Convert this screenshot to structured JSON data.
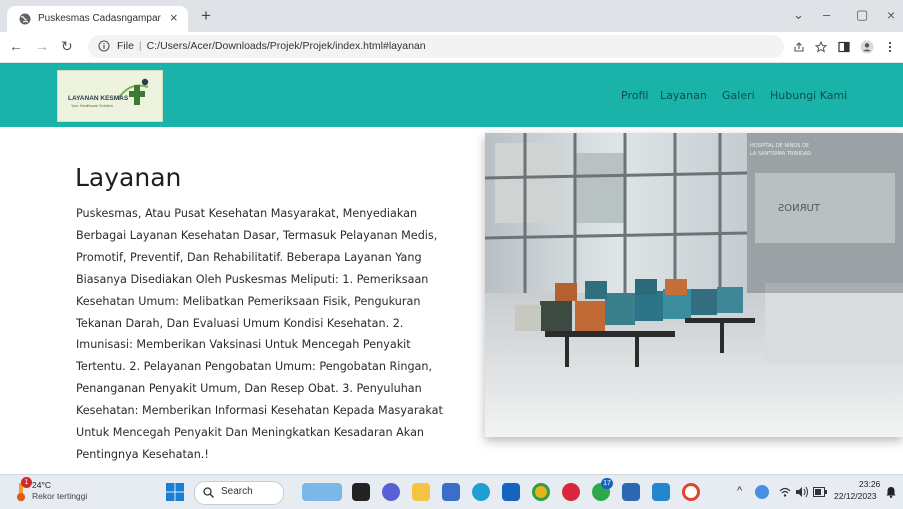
{
  "browser": {
    "tab_title": "Puskesmas Cadasngampar",
    "tab_close": "×",
    "new_tab": "+",
    "window_controls": [
      "⌄",
      "–",
      "▢",
      "×"
    ],
    "url_scheme": "File",
    "url_path": "C:/Users/Acer/Downloads/Projek/Projek/index.html#layanan",
    "nav": {
      "back": "←",
      "forward": "→",
      "reload": "↻"
    },
    "toolbar_icons": [
      "share",
      "star",
      "sidepanel",
      "profile",
      "menu"
    ]
  },
  "site": {
    "logo_title": "LAYANAN KESMAS",
    "logo_subtitle": "Your Healthcare Solution",
    "menu": [
      "Profil",
      "Layanan",
      "Galeri",
      "Hubungi Kami"
    ],
    "accent_color": "#19b3aa"
  },
  "section": {
    "heading": "Layanan",
    "body": "Puskesmas, Atau Pusat Kesehatan Masyarakat, Menyediakan Berbagai Layanan Kesehatan Dasar, Termasuk Pelayanan Medis, Promotif, Preventif, Dan Rehabilitatif. Beberapa Layanan Yang Biasanya Disediakan Oleh Puskesmas Meliputi: 1. Pemeriksaan Kesehatan Umum: Melibatkan Pemeriksaan Fisik, Pengukuran Tekanan Darah, Dan Evaluasi Umum Kondisi Kesehatan. 2. Imunisasi: Memberikan Vaksinasi Untuk Mencegah Penyakit Tertentu. 2. Pelayanan Pengobatan Umum: Pengobatan Ringan, Penanganan Penyakit Umum, Dan Resep Obat. 3. Penyuluhan Kesehatan: Memberikan Informasi Kesehatan Kepada Masyarakat Untuk Mencegah Penyakit Dan Meningkatkan Kesadaran Akan Pentingnya Kesehatan.!",
    "image_sign_1": "HOSPITAL DE NIÑOS DE",
    "image_sign_2": "LA SANTISIMA TRINIDAD",
    "image_sign_3": "TURNOS"
  },
  "taskbar": {
    "weather_temp": "24°C",
    "weather_text": "Rekor tertinggi",
    "weather_badge": "1",
    "search_label": "Search",
    "notif_badge": "17",
    "clock_time": "23:26",
    "clock_date": "22/12/2023"
  }
}
